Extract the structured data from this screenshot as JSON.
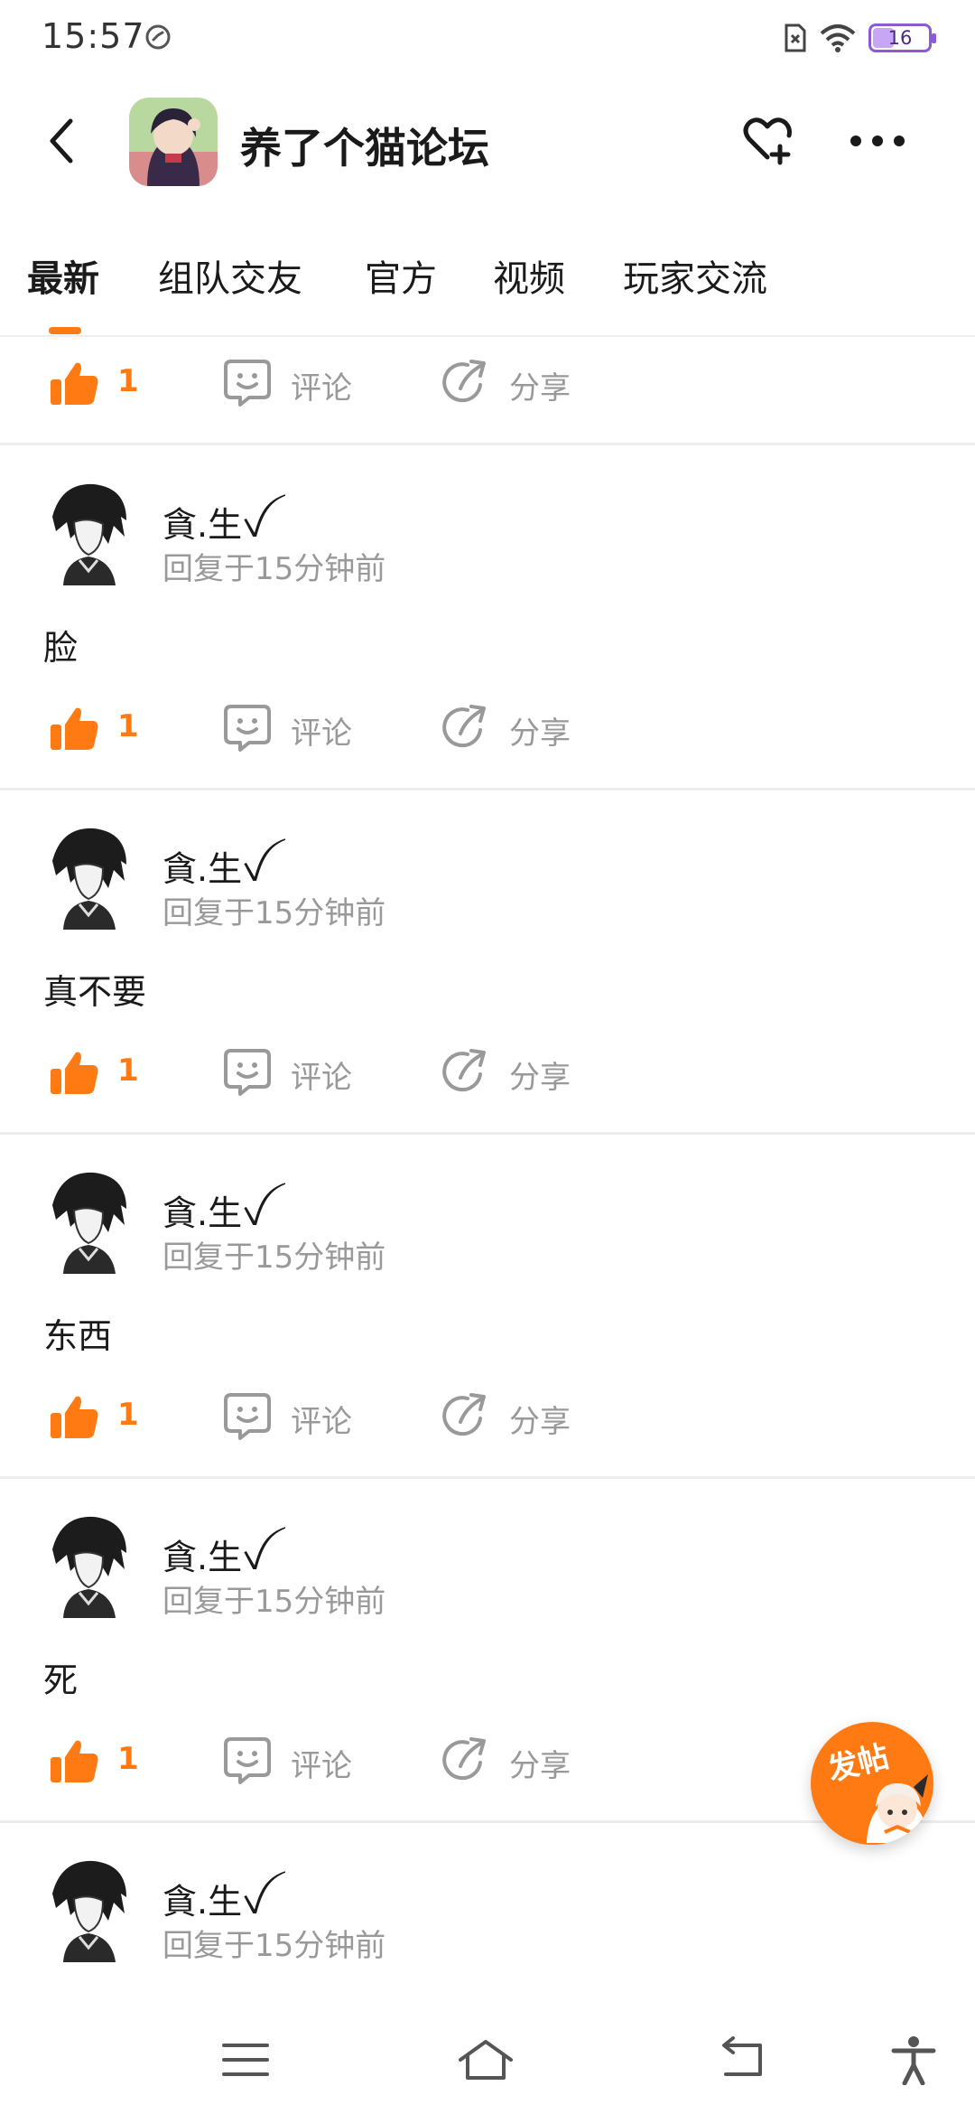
{
  "status_bar": {
    "time": "15:57",
    "app_icon": "speedometer-icon",
    "battery_level": "16",
    "accent_color": "#8c5ad6"
  },
  "header": {
    "title": "养了个猫论坛",
    "back_icon": "chevron-left-icon",
    "follow_icon": "heart-plus-icon",
    "more_icon": "more-horizontal-icon"
  },
  "tabs": [
    {
      "label": "最新",
      "active": true
    },
    {
      "label": "组队交友",
      "active": false
    },
    {
      "label": "官方",
      "active": false
    },
    {
      "label": "视频",
      "active": false
    },
    {
      "label": "玩家交流",
      "active": false
    }
  ],
  "labels": {
    "comment": "评论",
    "share": "分享"
  },
  "top_actions": {
    "likes": "1"
  },
  "posts": [
    {
      "author": "貪.生ꪜ",
      "time": "回复于15分钟前",
      "content": "脸",
      "likes": "1"
    },
    {
      "author": "貪.生ꪜ",
      "time": "回复于15分钟前",
      "content": "真不要",
      "likes": "1"
    },
    {
      "author": "貪.生ꪜ",
      "time": "回复于15分钟前",
      "content": "东西",
      "likes": "1"
    },
    {
      "author": "貪.生ꪜ",
      "time": "回复于15分钟前",
      "content": "死",
      "likes": "1"
    },
    {
      "author": "貪.生ꪜ",
      "time": "回复于15分钟前",
      "content": "",
      "likes": ""
    }
  ],
  "fab": {
    "label": "发帖"
  },
  "colors": {
    "accent": "#ff7a12",
    "muted_text": "#999999",
    "divider": "#ededed"
  }
}
